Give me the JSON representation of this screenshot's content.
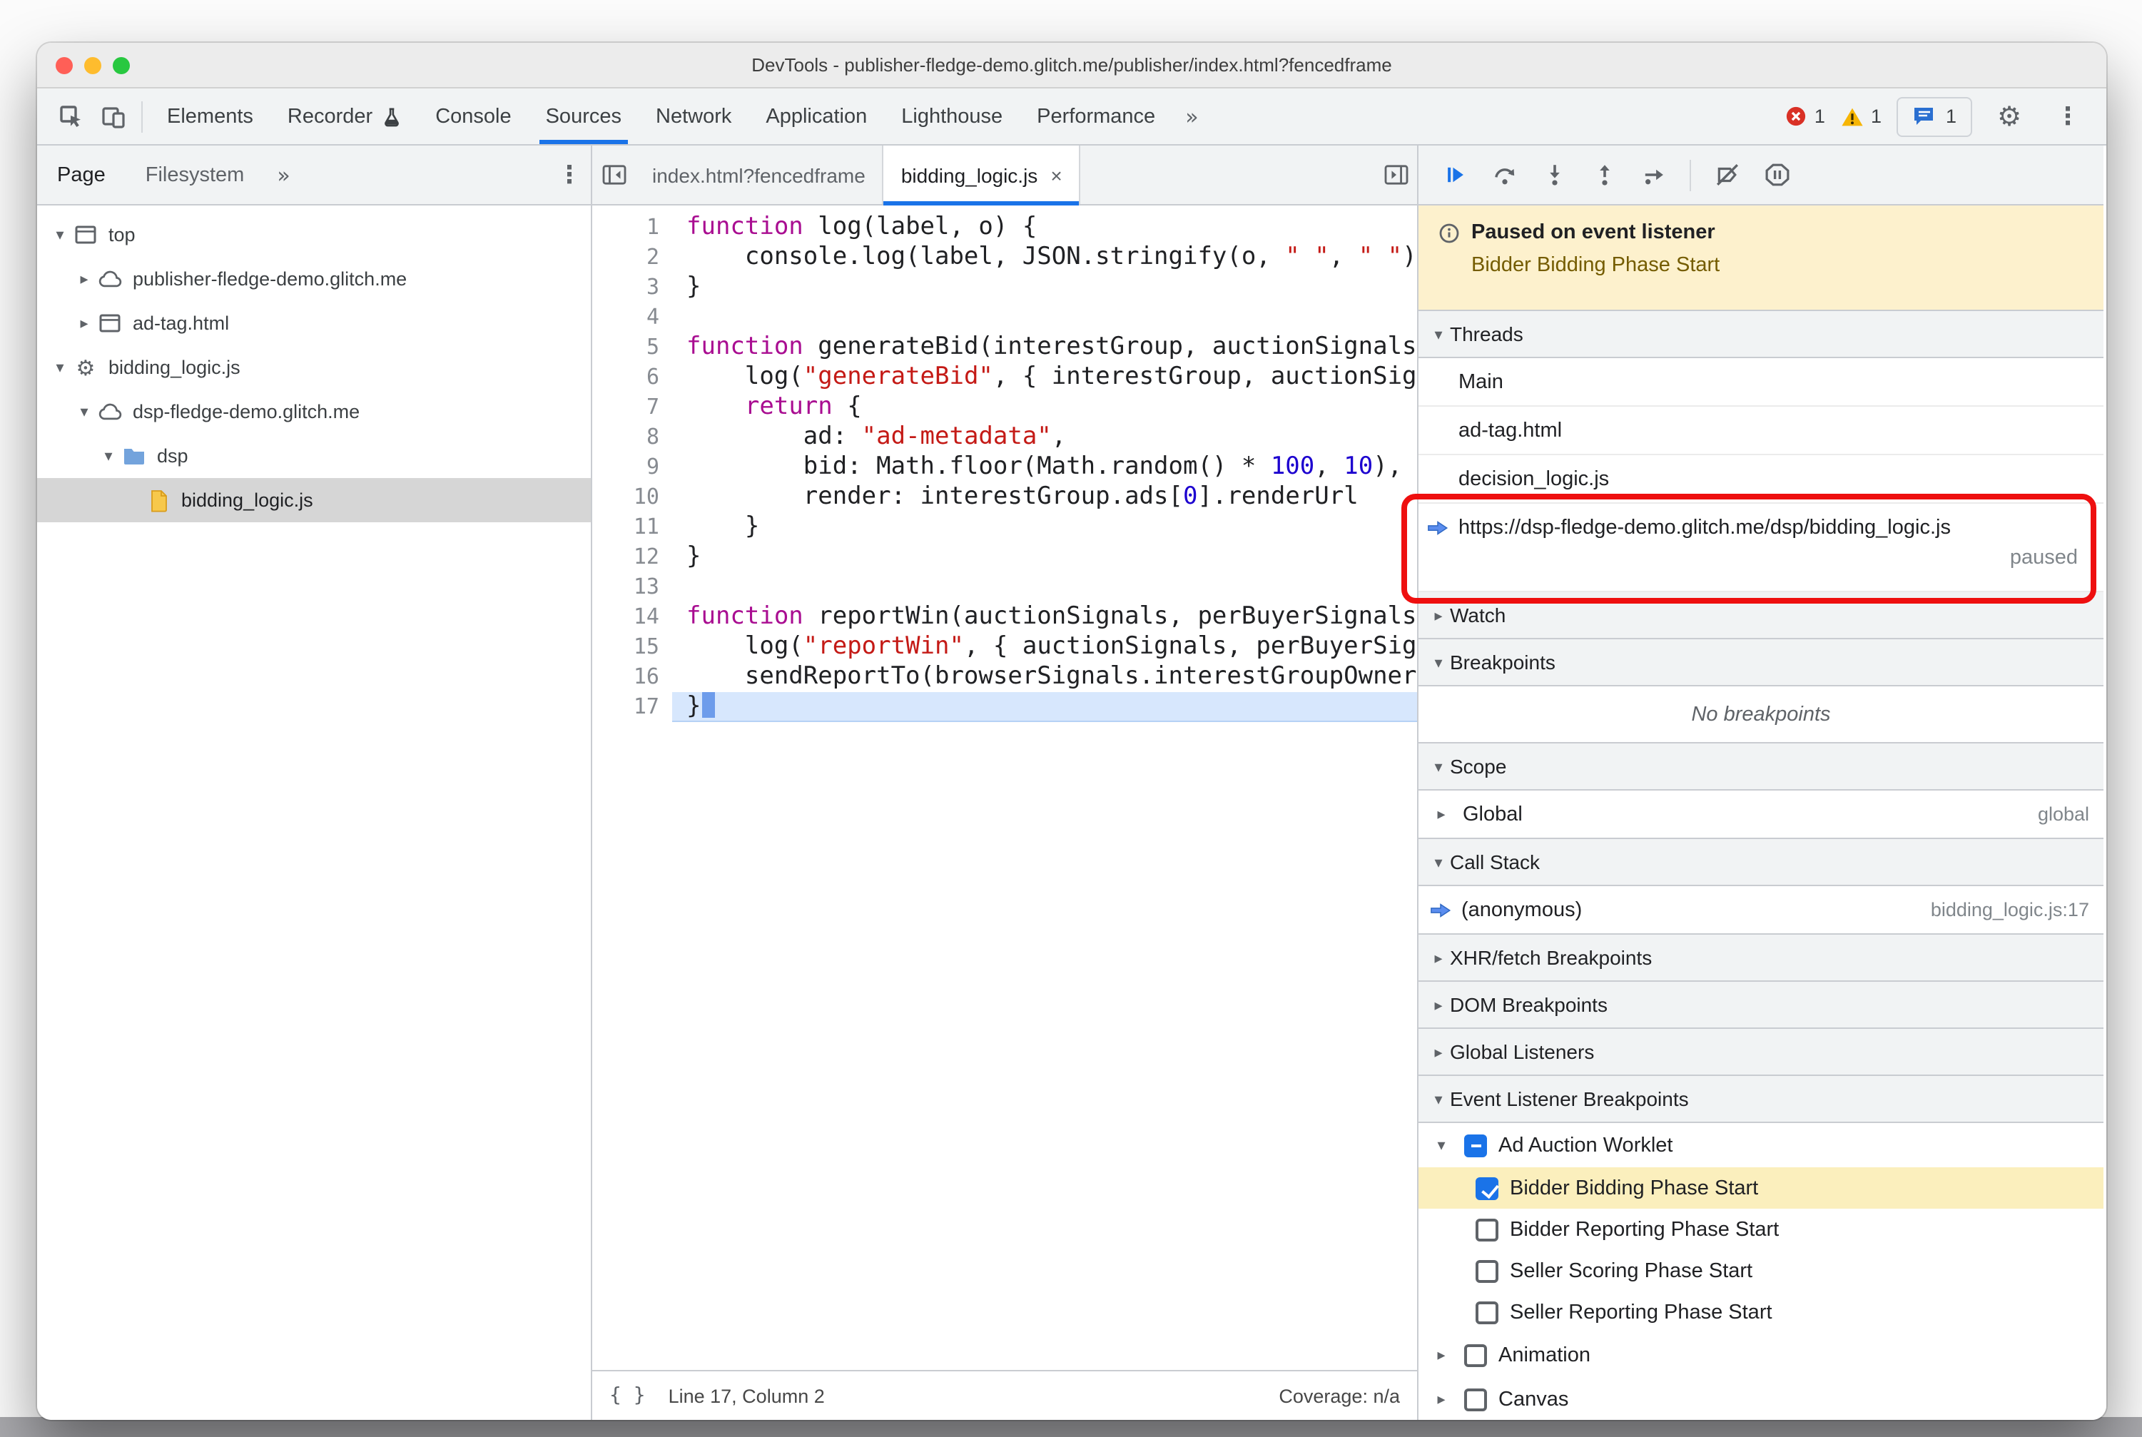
{
  "window": {
    "title": "DevTools - publisher-fledge-demo.glitch.me/publisher/index.html?fencedframe"
  },
  "main_toolbar": {
    "tabs": [
      {
        "label": "Elements"
      },
      {
        "label": "Recorder",
        "badge": "flask-icon"
      },
      {
        "label": "Console"
      },
      {
        "label": "Sources",
        "selected": true
      },
      {
        "label": "Network"
      },
      {
        "label": "Application"
      },
      {
        "label": "Lighthouse"
      },
      {
        "label": "Performance"
      }
    ],
    "more_tabs_label": "»",
    "error_count": "1",
    "warning_count": "1",
    "issue_count": "1"
  },
  "navigator": {
    "tabs": [
      {
        "label": "Page",
        "selected": true
      },
      {
        "label": "Filesystem"
      }
    ],
    "more_label": "»",
    "tree": [
      {
        "label": "top",
        "icon": "frame-icon",
        "caret": "expanded",
        "indent": 0
      },
      {
        "label": "publisher-fledge-demo.glitch.me",
        "icon": "cloud-icon",
        "caret": "collapsed",
        "indent": 1
      },
      {
        "label": "ad-tag.html",
        "icon": "frame-icon",
        "caret": "collapsed",
        "indent": 1
      },
      {
        "label": "bidding_logic.js",
        "icon": "gear-icon",
        "caret": "expanded",
        "indent": 0
      },
      {
        "label": "dsp-fledge-demo.glitch.me",
        "icon": "cloud-icon",
        "caret": "expanded",
        "indent": 1
      },
      {
        "label": "dsp",
        "icon": "folder-icon",
        "caret": "expanded",
        "indent": 2
      },
      {
        "label": "bidding_logic.js",
        "icon": "file-icon",
        "caret": "none",
        "indent": 3,
        "selected": true
      }
    ]
  },
  "editor": {
    "tabs": [
      {
        "label": "index.html?fencedframe",
        "active": false
      },
      {
        "label": "bidding_logic.js",
        "active": true,
        "close": "×"
      }
    ],
    "paused_line": 17,
    "lines": [
      [
        [
          "k",
          "function"
        ],
        [
          "p",
          " log(label, o) {"
        ]
      ],
      [
        [
          "p",
          "    console.log(label, JSON.stringify(o, "
        ],
        [
          "s",
          "\" \""
        ],
        [
          "p",
          ", "
        ],
        [
          "s",
          "\" \""
        ],
        [
          "p",
          "))"
        ]
      ],
      [
        [
          "p",
          "}"
        ]
      ],
      [],
      [
        [
          "k",
          "function"
        ],
        [
          "p",
          " generateBid(interestGroup, auctionSignals, perBuyerSignals, trustedBiddingSignals, browserSignals) {"
        ]
      ],
      [
        [
          "p",
          "    log("
        ],
        [
          "s",
          "\"generateBid\""
        ],
        [
          "p",
          ", { interestGroup, auctionSignals, perBuyerSignals, trustedBiddingSignals, browserSignals });"
        ]
      ],
      [
        [
          "p",
          "    "
        ],
        [
          "k",
          "return"
        ],
        [
          "p",
          " {"
        ]
      ],
      [
        [
          "p",
          "        ad: "
        ],
        [
          "s",
          "\"ad-metadata\""
        ],
        [
          "p",
          ","
        ]
      ],
      [
        [
          "p",
          "        bid: Math.floor(Math.random() * "
        ],
        [
          "n",
          "100"
        ],
        [
          "p",
          ", "
        ],
        [
          "n",
          "10"
        ],
        [
          "p",
          "),"
        ]
      ],
      [
        [
          "p",
          "        render: interestGroup.ads["
        ],
        [
          "n",
          "0"
        ],
        [
          "p",
          "].renderUrl"
        ]
      ],
      [
        [
          "p",
          "    }"
        ]
      ],
      [
        [
          "p",
          "}"
        ]
      ],
      [],
      [
        [
          "k",
          "function"
        ],
        [
          "p",
          " reportWin(auctionSignals, perBuyerSignals, sellerSignals, browserSignals) {"
        ]
      ],
      [
        [
          "p",
          "    log("
        ],
        [
          "s",
          "\"reportWin\""
        ],
        [
          "p",
          ", { auctionSignals, perBuyerSignals, sellerSignals, browserSignals });"
        ]
      ],
      [
        [
          "p",
          "    sendReportTo(browserSignals.interestGroupOwner);"
        ]
      ],
      [
        [
          "p",
          "}"
        ]
      ]
    ],
    "status": {
      "format_label": "{ }",
      "line_col": "Line 17, Column 2",
      "coverage": "Coverage: n/a"
    }
  },
  "debugger": {
    "paused_banner": {
      "title": "Paused on event listener",
      "detail": "Bidder Bidding Phase Start"
    },
    "threads": {
      "title": "Threads",
      "items": [
        {
          "label": "Main"
        },
        {
          "label": "ad-tag.html"
        },
        {
          "label": "decision_logic.js"
        },
        {
          "label": "https://dsp-fledge-demo.glitch.me/dsp/bidding_logic.js",
          "status": "paused",
          "current": true,
          "annotated": true
        }
      ]
    },
    "watch": {
      "title": "Watch"
    },
    "breakpoints": {
      "title": "Breakpoints",
      "empty_text": "No breakpoints"
    },
    "scope": {
      "title": "Scope",
      "rows": [
        {
          "label": "Global",
          "hint": "global"
        }
      ]
    },
    "call_stack": {
      "title": "Call Stack",
      "frames": [
        {
          "label": "(anonymous)",
          "location": "bidding_logic.js:17",
          "current": true
        }
      ]
    },
    "xhr_breakpoints": {
      "title": "XHR/fetch Breakpoints"
    },
    "dom_breakpoints": {
      "title": "DOM Breakpoints"
    },
    "global_listeners": {
      "title": "Global Listeners"
    },
    "event_listener_breakpoints": {
      "title": "Event Listener Breakpoints",
      "items": [
        {
          "label": "Ad Auction Worklet",
          "checkbox": "indeterminate",
          "caret": "expanded",
          "children": [
            {
              "label": "Bidder Bidding Phase Start",
              "checkbox": "checked",
              "highlighted": true
            },
            {
              "label": "Bidder Reporting Phase Start",
              "checkbox": "unchecked"
            },
            {
              "label": "Seller Scoring Phase Start",
              "checkbox": "unchecked"
            },
            {
              "label": "Seller Reporting Phase Start",
              "checkbox": "unchecked"
            }
          ]
        },
        {
          "label": "Animation",
          "checkbox": "unchecked",
          "caret": "collapsed"
        },
        {
          "label": "Canvas",
          "checkbox": "unchecked",
          "caret": "collapsed"
        }
      ]
    }
  },
  "colors": {
    "accent": "#1a73e8",
    "annotation_red": "#ee0f0f",
    "paused_banner_bg": "#fdf1cd",
    "event_row_highlight_bg": "#fbefbd",
    "exec_line_bg": "#d7e7fd",
    "keyword": "#a90d91",
    "string": "#c41a16",
    "number": "#1c00cf"
  }
}
